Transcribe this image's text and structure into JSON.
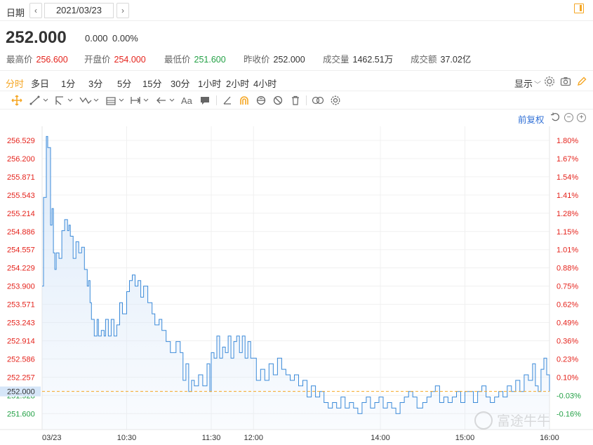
{
  "header": {
    "date_label": "日期",
    "prev_icon": "chevron-left-icon",
    "next_icon": "chevron-right-icon",
    "date_value": "2021/03/23",
    "panel_icon": "panel-toggle-icon"
  },
  "quote": {
    "price": "252.000",
    "change": "0.000",
    "change_pct": "0.00%",
    "stats": [
      {
        "label": "最高价",
        "value": "256.600",
        "color": "up"
      },
      {
        "label": "开盘价",
        "value": "254.000",
        "color": "up"
      },
      {
        "label": "最低价",
        "value": "251.600",
        "color": "down"
      },
      {
        "label": "昨收价",
        "value": "252.000",
        "color": "neutral"
      },
      {
        "label": "成交量",
        "value": "1462.51万",
        "color": "neutral"
      },
      {
        "label": "成交额",
        "value": "37.02亿",
        "color": "neutral"
      }
    ]
  },
  "periods": [
    "分时",
    "多日",
    "1分",
    "3分",
    "5分",
    "15分",
    "30分",
    "1小时",
    "2小时",
    "4小时"
  ],
  "active_period": "分时",
  "display_label": "显示",
  "adjust_label": "前复权",
  "tools": {
    "text_tool_label": "Aa"
  },
  "colors": {
    "accent": "#f5a623",
    "up": "#e5241d",
    "down": "#24a146",
    "line": "#3b8ad9",
    "area": "#dbe9f9",
    "baseline": "#f5a623",
    "link": "#2f6fd6"
  },
  "watermark": "富途牛牛",
  "chart_data": {
    "type": "line",
    "prev_close": 252.0,
    "current_price_label": "252.000",
    "y_ticks_left": [
      "256.529",
      "256.200",
      "255.871",
      "255.543",
      "255.214",
      "254.886",
      "254.557",
      "254.229",
      "253.900",
      "253.571",
      "253.243",
      "252.914",
      "252.586",
      "252.257",
      "251.928",
      "251.600"
    ],
    "y_ticks_right": [
      "1.80%",
      "1.67%",
      "1.54%",
      "1.41%",
      "1.28%",
      "1.15%",
      "1.01%",
      "0.88%",
      "0.75%",
      "0.62%",
      "0.49%",
      "0.36%",
      "0.23%",
      "0.10%",
      "-0.03%",
      "-0.16%"
    ],
    "ylim": [
      251.45,
      256.65
    ],
    "x_ticks": [
      {
        "label": "03/23",
        "t": 0
      },
      {
        "label": "10:30",
        "t": 60
      },
      {
        "label": "11:30",
        "t": 120
      },
      {
        "label": "12:00",
        "t": 150
      },
      {
        "label": "14:00",
        "t": 240
      },
      {
        "label": "15:00",
        "t": 300
      },
      {
        "label": "16:00",
        "t": 360
      }
    ],
    "xlim": [
      0,
      360
    ],
    "series": [
      {
        "values": [
          [
            0,
            253.9
          ],
          [
            1,
            255.5
          ],
          [
            3,
            256.6
          ],
          [
            4,
            256.4
          ],
          [
            6,
            255.0
          ],
          [
            7,
            255.3
          ],
          [
            8,
            254.5
          ],
          [
            9,
            254.2
          ],
          [
            10,
            254.5
          ],
          [
            12,
            254.4
          ],
          [
            14,
            254.9
          ],
          [
            16,
            255.1
          ],
          [
            18,
            254.9
          ],
          [
            19,
            255.0
          ],
          [
            20,
            254.8
          ],
          [
            22,
            254.4
          ],
          [
            24,
            254.7
          ],
          [
            26,
            254.5
          ],
          [
            28,
            254.6
          ],
          [
            30,
            254.2
          ],
          [
            32,
            253.9
          ],
          [
            33,
            254.0
          ],
          [
            34,
            253.6
          ],
          [
            35,
            253.3
          ],
          [
            37,
            253.0
          ],
          [
            39,
            253.3
          ],
          [
            40,
            253.0
          ],
          [
            42,
            253.1
          ],
          [
            44,
            253.0
          ],
          [
            45,
            253.3
          ],
          [
            47,
            253.0
          ],
          [
            49,
            253.3
          ],
          [
            51,
            253.0
          ],
          [
            53,
            253.2
          ],
          [
            55,
            253.6
          ],
          [
            57,
            253.4
          ],
          [
            60,
            253.8
          ],
          [
            62,
            254.0
          ],
          [
            64,
            254.1
          ],
          [
            66,
            253.9
          ],
          [
            68,
            254.0
          ],
          [
            70,
            253.7
          ],
          [
            72,
            253.9
          ],
          [
            75,
            253.6
          ],
          [
            78,
            253.4
          ],
          [
            80,
            253.2
          ],
          [
            83,
            253.3
          ],
          [
            85,
            253.1
          ],
          [
            88,
            252.9
          ],
          [
            91,
            252.7
          ],
          [
            95,
            252.9
          ],
          [
            98,
            252.7
          ],
          [
            100,
            252.2
          ],
          [
            102,
            252.5
          ],
          [
            104,
            252.0
          ],
          [
            106,
            252.2
          ],
          [
            108,
            252.1
          ],
          [
            111,
            252.3
          ],
          [
            114,
            252.1
          ],
          [
            117,
            252.5
          ],
          [
            119,
            252.0
          ],
          [
            120,
            252.7
          ],
          [
            122,
            252.6
          ],
          [
            124,
            253.0
          ],
          [
            126,
            252.6
          ],
          [
            128,
            252.8
          ],
          [
            130,
            252.7
          ],
          [
            132,
            253.0
          ],
          [
            134,
            252.6
          ],
          [
            136,
            252.9
          ],
          [
            138,
            253.0
          ],
          [
            140,
            252.7
          ],
          [
            142,
            253.0
          ],
          [
            144,
            252.6
          ],
          [
            146,
            252.9
          ],
          [
            148,
            252.6
          ],
          [
            150,
            252.6
          ],
          [
            152,
            252.2
          ],
          [
            155,
            252.4
          ],
          [
            158,
            252.2
          ],
          [
            161,
            252.5
          ],
          [
            164,
            252.3
          ],
          [
            167,
            252.6
          ],
          [
            170,
            252.4
          ],
          [
            173,
            252.3
          ],
          [
            176,
            252.2
          ],
          [
            179,
            252.3
          ],
          [
            182,
            252.1
          ],
          [
            185,
            252.2
          ],
          [
            188,
            251.9
          ],
          [
            191,
            252.1
          ],
          [
            194,
            251.9
          ],
          [
            197,
            252.0
          ],
          [
            200,
            251.8
          ],
          [
            203,
            251.7
          ],
          [
            206,
            251.8
          ],
          [
            209,
            251.7
          ],
          [
            212,
            251.9
          ],
          [
            215,
            251.7
          ],
          [
            218,
            251.8
          ],
          [
            221,
            251.7
          ],
          [
            224,
            251.6
          ],
          [
            227,
            251.8
          ],
          [
            230,
            251.9
          ],
          [
            233,
            251.7
          ],
          [
            236,
            251.8
          ],
          [
            239,
            251.9
          ],
          [
            242,
            251.7
          ],
          [
            245,
            251.8
          ],
          [
            248,
            251.7
          ],
          [
            251,
            251.6
          ],
          [
            254,
            251.8
          ],
          [
            257,
            251.9
          ],
          [
            260,
            252.0
          ],
          [
            263,
            251.9
          ],
          [
            266,
            251.7
          ],
          [
            270,
            251.8
          ],
          [
            273,
            251.9
          ],
          [
            276,
            252.0
          ],
          [
            279,
            252.1
          ],
          [
            282,
            251.8
          ],
          [
            285,
            251.9
          ],
          [
            288,
            251.8
          ],
          [
            291,
            251.9
          ],
          [
            294,
            252.0
          ],
          [
            297,
            251.8
          ],
          [
            300,
            252.0
          ],
          [
            303,
            252.0
          ],
          [
            306,
            251.8
          ],
          [
            309,
            252.0
          ],
          [
            312,
            252.1
          ],
          [
            315,
            251.9
          ],
          [
            318,
            251.8
          ],
          [
            321,
            251.9
          ],
          [
            324,
            252.0
          ],
          [
            327,
            251.9
          ],
          [
            330,
            252.1
          ],
          [
            333,
            252.0
          ],
          [
            336,
            252.2
          ],
          [
            339,
            252.0
          ],
          [
            342,
            252.3
          ],
          [
            345,
            252.2
          ],
          [
            348,
            252.5
          ],
          [
            350,
            252.1
          ],
          [
            352,
            252.0
          ],
          [
            354,
            252.4
          ],
          [
            356,
            252.6
          ],
          [
            358,
            252.3
          ],
          [
            360,
            252.0
          ]
        ]
      }
    ]
  }
}
